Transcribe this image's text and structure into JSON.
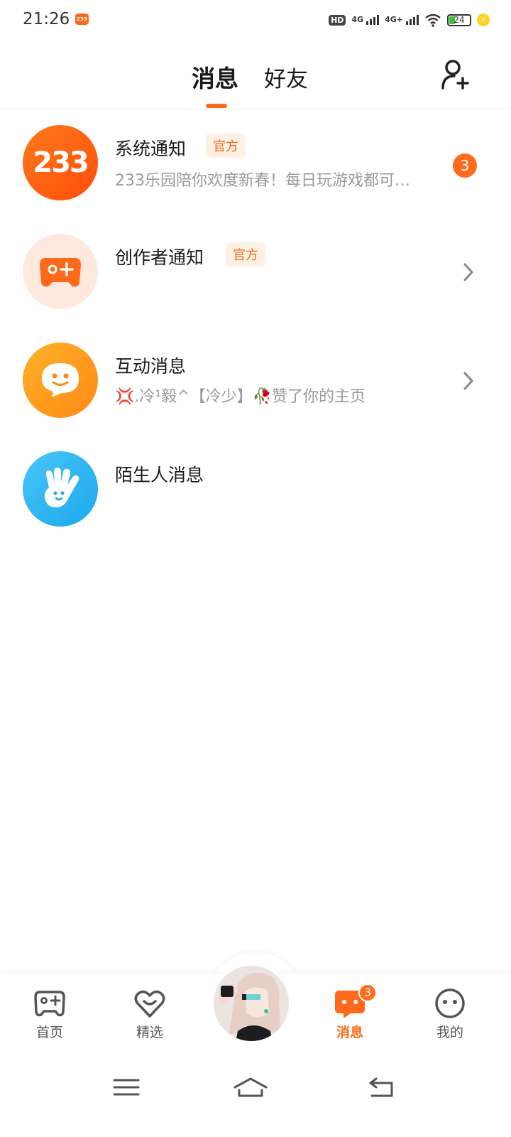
{
  "status_bar": {
    "time": "21:26",
    "app_icon_text": "233",
    "hd_label": "HD",
    "network_1": "4G",
    "network_2": "4G+",
    "battery": "24"
  },
  "header": {
    "tabs": [
      {
        "label": "消息",
        "active": true
      },
      {
        "label": "好友",
        "active": false
      }
    ],
    "add_friend_icon": "add-user-icon"
  },
  "messages": [
    {
      "title": "系统通知",
      "tag": "官方",
      "subtitle": "233乐园陪你欢度新春！每日玩游戏都可…",
      "badge": "3",
      "avatar_text": "233"
    },
    {
      "title": "创作者通知",
      "tag": "官方",
      "subtitle": "",
      "badge": null
    },
    {
      "title": "互动消息",
      "tag": null,
      "subtitle": "💢.冷¹毅^【冷少】🥀赞了你的主页",
      "badge": null
    },
    {
      "title": "陌生人消息",
      "tag": null,
      "subtitle": "",
      "badge": null
    }
  ],
  "bottom_nav": {
    "items": [
      {
        "label": "首页",
        "icon": "gamepad-icon",
        "active": false
      },
      {
        "label": "精选",
        "icon": "heart-icon",
        "active": false
      },
      {
        "label": "消息",
        "icon": "chat-icon",
        "active": true,
        "badge": "3"
      },
      {
        "label": "我的",
        "icon": "smile-icon",
        "active": false
      }
    ]
  },
  "colors": {
    "accent": "#ff6a1a",
    "tag_bg": "#fff0e4",
    "blue": "#2bb4f2"
  }
}
